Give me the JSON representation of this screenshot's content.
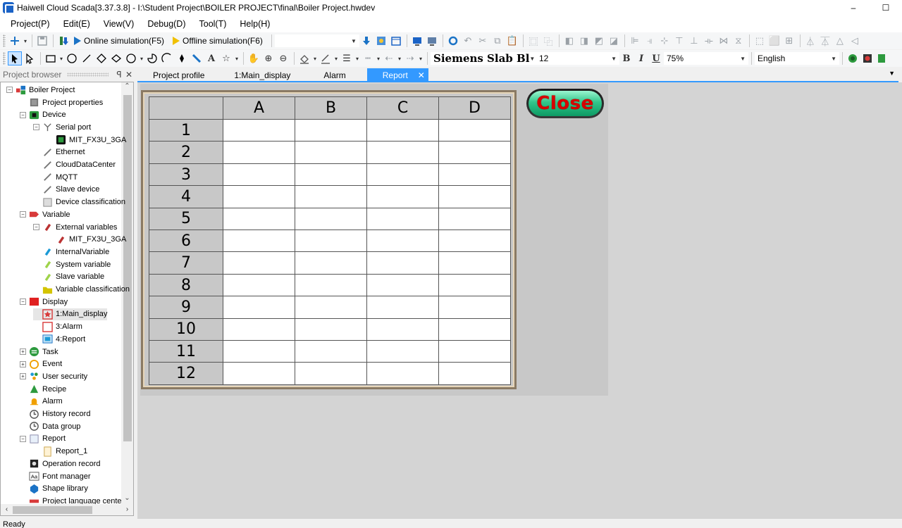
{
  "window": {
    "title": "Haiwell Cloud Scada[3.37.3.8] - I:\\Student Project\\BOILER PROJECT\\final\\Boiler Project.hwdev",
    "minimize": "–",
    "maximize": "☐"
  },
  "menu": [
    "Project(P)",
    "Edit(E)",
    "View(V)",
    "Debug(D)",
    "Tool(T)",
    "Help(H)"
  ],
  "toolbar": {
    "online_sim": "Online simulation(F5)",
    "offline_sim": "Offline simulation(F6)",
    "font_name": "Siemens Slab Bl",
    "font_size": "12",
    "bold": "B",
    "italic": "I",
    "underline": "U",
    "zoom": "75%",
    "language": "English"
  },
  "panel": {
    "title": "Project browser",
    "pin": "ꟼ",
    "close": "✕"
  },
  "tree": [
    {
      "label": "Boiler Project",
      "indent": 0,
      "exp": "−",
      "icon": "project-icon"
    },
    {
      "label": "Project properties",
      "indent": 1,
      "exp": "",
      "icon": "properties-icon"
    },
    {
      "label": "Device",
      "indent": 1,
      "exp": "−",
      "icon": "device-icon"
    },
    {
      "label": "Serial port",
      "indent": 2,
      "exp": "−",
      "icon": "serial-port-icon"
    },
    {
      "label": "MIT_FX3U_3GA",
      "indent": 3,
      "exp": "",
      "icon": "plc-icon"
    },
    {
      "label": "Ethernet",
      "indent": 2,
      "exp": "",
      "icon": "ethernet-icon"
    },
    {
      "label": "CloudDataCenter",
      "indent": 2,
      "exp": "",
      "icon": "cloud-icon"
    },
    {
      "label": "MQTT",
      "indent": 2,
      "exp": "",
      "icon": "mqtt-icon"
    },
    {
      "label": "Slave device",
      "indent": 2,
      "exp": "",
      "icon": "slave-device-icon"
    },
    {
      "label": "Device classification",
      "indent": 2,
      "exp": "",
      "icon": "classification-icon"
    },
    {
      "label": "Variable",
      "indent": 1,
      "exp": "−",
      "icon": "variable-icon"
    },
    {
      "label": "External variables",
      "indent": 2,
      "exp": "−",
      "icon": "external-variable-icon"
    },
    {
      "label": "MIT_FX3U_3GA",
      "indent": 3,
      "exp": "",
      "icon": "tag-icon"
    },
    {
      "label": "InternalVariable",
      "indent": 2,
      "exp": "",
      "icon": "internal-variable-icon"
    },
    {
      "label": "System variable",
      "indent": 2,
      "exp": "",
      "icon": "system-variable-icon"
    },
    {
      "label": "Slave variable",
      "indent": 2,
      "exp": "",
      "icon": "slave-variable-icon"
    },
    {
      "label": "Variable classification",
      "indent": 2,
      "exp": "",
      "icon": "folder-icon"
    },
    {
      "label": "Display",
      "indent": 1,
      "exp": "−",
      "icon": "display-icon"
    },
    {
      "label": "1:Main_display",
      "indent": 2,
      "exp": "",
      "icon": "main-display-icon"
    },
    {
      "label": "3:Alarm",
      "indent": 2,
      "exp": "",
      "icon": "alarm-display-icon"
    },
    {
      "label": "4:Report",
      "indent": 2,
      "exp": "",
      "icon": "report-display-icon"
    },
    {
      "label": "Task",
      "indent": 1,
      "exp": "+",
      "icon": "task-icon"
    },
    {
      "label": "Event",
      "indent": 1,
      "exp": "+",
      "icon": "event-icon"
    },
    {
      "label": "User security",
      "indent": 1,
      "exp": "+",
      "icon": "user-security-icon"
    },
    {
      "label": "Recipe",
      "indent": 1,
      "exp": "",
      "icon": "recipe-icon"
    },
    {
      "label": "Alarm",
      "indent": 1,
      "exp": "",
      "icon": "alarm-bell-icon"
    },
    {
      "label": "History record",
      "indent": 1,
      "exp": "",
      "icon": "history-icon"
    },
    {
      "label": "Data group",
      "indent": 1,
      "exp": "",
      "icon": "data-group-icon"
    },
    {
      "label": "Report",
      "indent": 1,
      "exp": "−",
      "icon": "report-icon"
    },
    {
      "label": "Report_1",
      "indent": 2,
      "exp": "",
      "icon": "report-file-icon"
    },
    {
      "label": "Operation record",
      "indent": 1,
      "exp": "",
      "icon": "operation-record-icon"
    },
    {
      "label": "Font manager",
      "indent": 1,
      "exp": "",
      "icon": "font-manager-icon"
    },
    {
      "label": "Shape library",
      "indent": 1,
      "exp": "",
      "icon": "shape-library-icon"
    },
    {
      "label": "Project language cente",
      "indent": 1,
      "exp": "",
      "icon": "language-icon"
    }
  ],
  "tabs": [
    {
      "label": "Project profile",
      "active": false
    },
    {
      "label": "1:Main_display",
      "active": false
    },
    {
      "label": "Alarm",
      "active": false
    },
    {
      "label": "Report",
      "active": true
    }
  ],
  "report_table": {
    "columns": [
      "A",
      "B",
      "C",
      "D"
    ],
    "rows": [
      "1",
      "2",
      "3",
      "4",
      "5",
      "6",
      "7",
      "8",
      "9",
      "10",
      "11",
      "12"
    ]
  },
  "close_button": "Close",
  "status": "Ready"
}
